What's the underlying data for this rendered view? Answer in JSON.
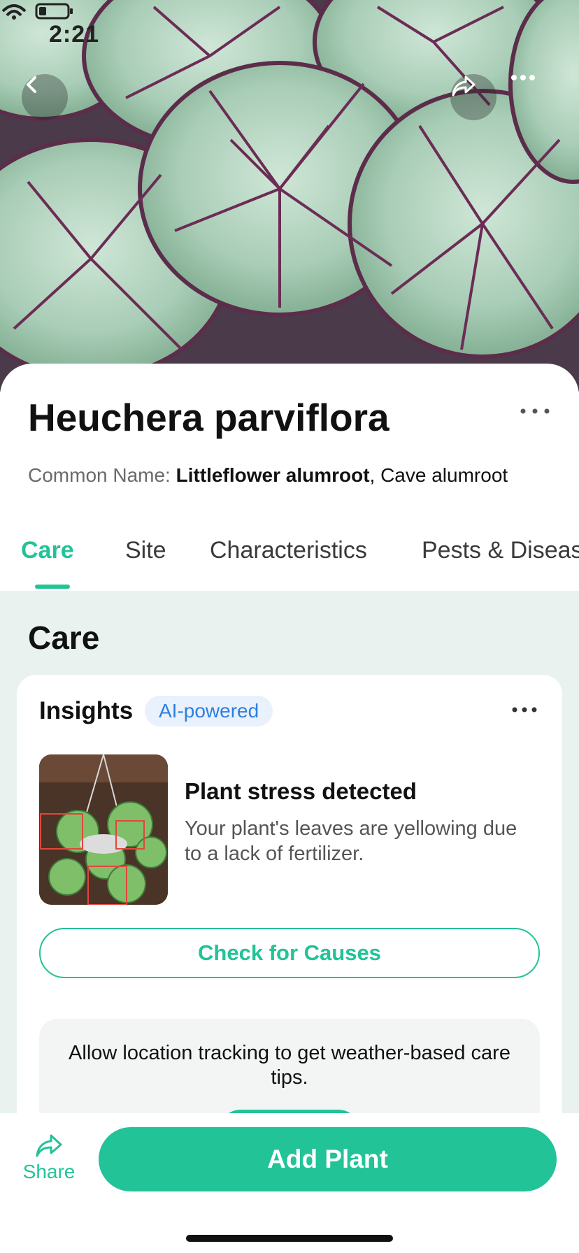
{
  "status_bar": {
    "time": "2:21"
  },
  "hero": {
    "icons": [
      "chevron-left-icon",
      "share-icon",
      "more-horizontal-icon"
    ]
  },
  "plant": {
    "title": "Heuchera parviflora",
    "common_name_label": "Common Name: ",
    "common_name_primary": "Littleflower alumroot",
    "common_name_rest": ", Cave alumroot"
  },
  "tabs": [
    {
      "label": "Care",
      "active": true
    },
    {
      "label": "Site",
      "active": false
    },
    {
      "label": "Characteristics",
      "active": false
    },
    {
      "label": "Pests & Diseases",
      "active": false
    }
  ],
  "section": {
    "title": "Care"
  },
  "insights": {
    "title": "Insights",
    "badge": "AI-powered",
    "stress_title": "Plant stress detected",
    "stress_desc": "Your plant's leaves are yellowing due to a lack of fertilizer.",
    "causes_button": "Check for Causes"
  },
  "location": {
    "text": "Allow location tracking to get weather-based care tips."
  },
  "bottom_bar": {
    "share_label": "Share",
    "add_button": "Add Plant"
  },
  "colors": {
    "accent": "#22c397",
    "badge_bg": "#e8f1fc",
    "badge_text": "#2e7ee0",
    "content_bg": "#e9f2ee"
  }
}
